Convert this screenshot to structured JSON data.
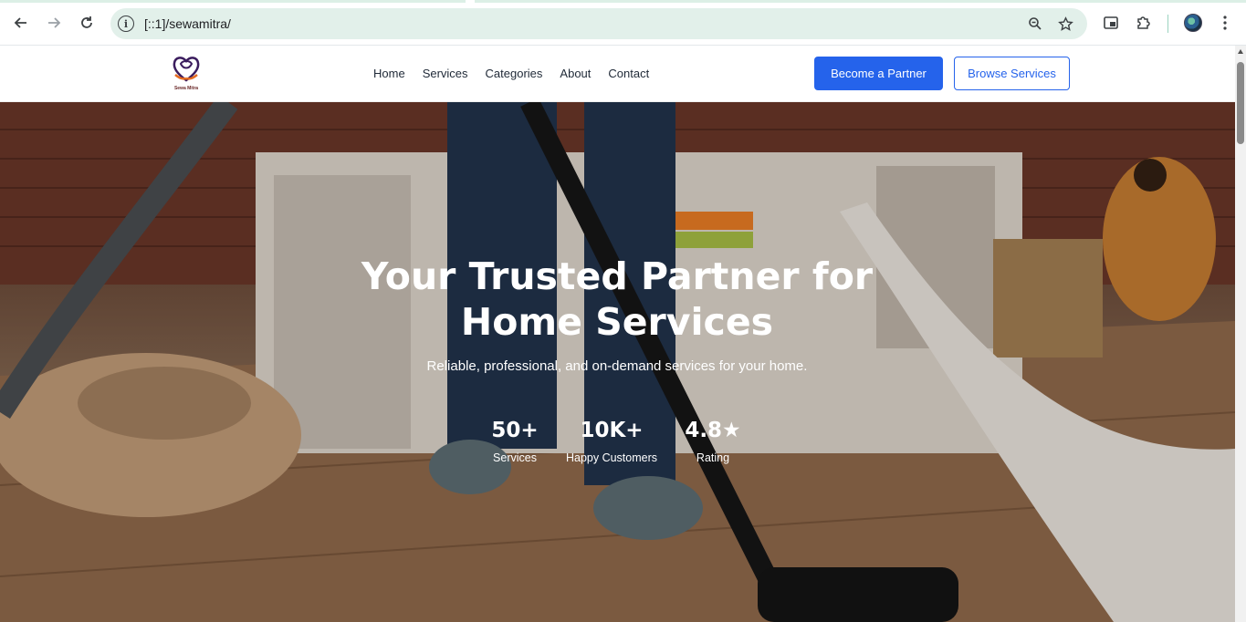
{
  "browser": {
    "url": "[::1]/sewamitra/",
    "icons": {
      "back": "arrow-left-icon",
      "forward": "arrow-right-icon",
      "reload": "reload-icon",
      "info": "info-icon",
      "zoom": "zoom-icon",
      "bookmark": "star-icon",
      "media": "media-icon",
      "extensions": "puzzle-icon",
      "menu": "kebab-menu-icon"
    }
  },
  "header": {
    "logo_text": "Sewa Mitra",
    "nav": [
      "Home",
      "Services",
      "Categories",
      "About",
      "Contact"
    ],
    "primary_button": "Become a Partner",
    "secondary_button": "Browse Services",
    "accent_color": "#2563eb"
  },
  "hero": {
    "title_line1": "Your Trusted Partner for",
    "title_line2": "Home Services",
    "subtitle": "Reliable, professional, and on-demand services for your home.",
    "stats": [
      {
        "value": "50+",
        "label": "Services"
      },
      {
        "value": "10K+",
        "label": "Happy Customers"
      },
      {
        "value": "4.8★",
        "label": "Rating"
      }
    ]
  }
}
